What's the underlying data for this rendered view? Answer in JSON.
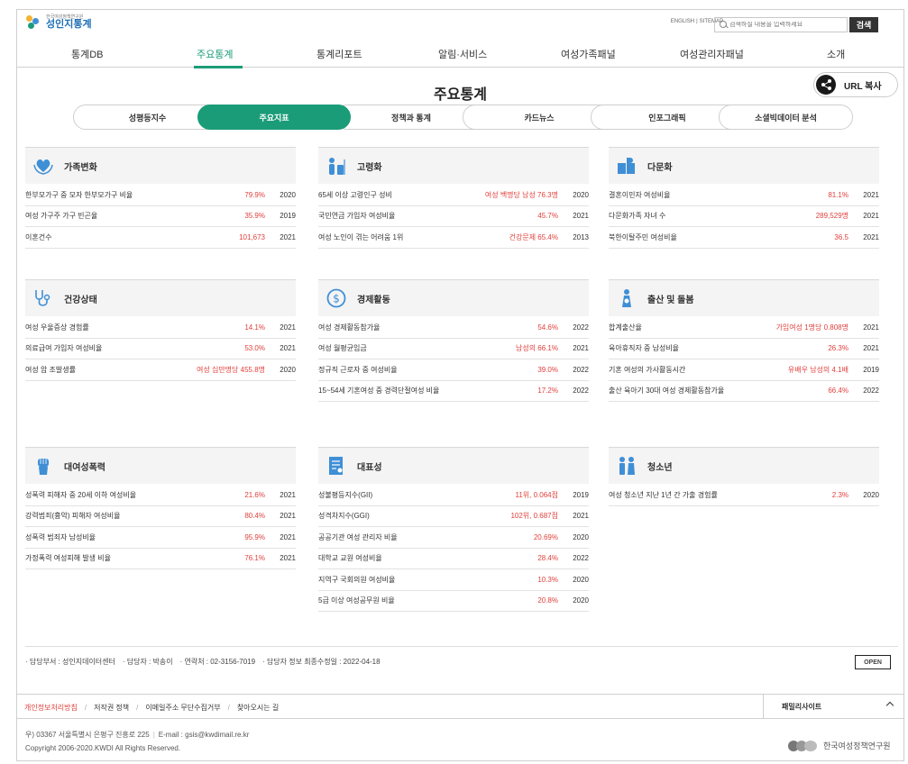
{
  "header": {
    "logo_small": "한국여성정책연구원",
    "logo_main": "성인지통계",
    "util_english": "ENGLISH",
    "util_sitemap": "SITEMAP",
    "search_placeholder": "검색하실 내용을 입력하세요",
    "search_button": "검색"
  },
  "gnb": [
    "통계DB",
    "주요통계",
    "통계리포트",
    "알림·서비스",
    "여성가족패널",
    "여성관리자패널",
    "소개"
  ],
  "gnb_active": "주요통계",
  "page_title": "주요통계",
  "url_copy": "URL 복사",
  "tabs": [
    "성평등지수",
    "주요지표",
    "정책과 통계",
    "카드뉴스",
    "인포그래픽",
    "소셜빅데이터 분석"
  ],
  "tab_active": "주요지표",
  "panels": [
    {
      "icon": "heart-hands-icon",
      "title": "가족변화",
      "rows": [
        {
          "label": "한부모가구 중 모자 한부모가구 비율",
          "value": "79.9%",
          "year": "2020"
        },
        {
          "label": "여성 가구주 가구 빈곤율",
          "value": "35.9%",
          "year": "2019"
        },
        {
          "label": "이혼건수",
          "value": "101,673",
          "year": "2021"
        }
      ]
    },
    {
      "icon": "elderly-icon",
      "title": "고령화",
      "rows": [
        {
          "label": "65세 이상 고령인구 성비",
          "value": "여성 백명당 남성 76.3명",
          "year": "2020"
        },
        {
          "label": "국민연금 가입자 여성비율",
          "value": "45.7%",
          "year": "2021"
        },
        {
          "label": "여성 노인이 겪는 어려움 1위",
          "value": "건강문제 65.4%",
          "year": "2013"
        }
      ]
    },
    {
      "icon": "puzzle-icon",
      "title": "다문화",
      "rows": [
        {
          "label": "결혼이민자 여성비율",
          "value": "81.1%",
          "year": "2021"
        },
        {
          "label": "다문화가족 자녀 수",
          "value": "289,529명",
          "year": "2021"
        },
        {
          "label": "북한이탈주민 여성비율",
          "value": "36.5",
          "year": "2021"
        }
      ]
    },
    {
      "icon": "stethoscope-icon",
      "title": "건강상태",
      "rows": [
        {
          "label": "여성 우울증상 경험률",
          "value": "14.1%",
          "year": "2021"
        },
        {
          "label": "의료급여 가입자 여성비율",
          "value": "53.0%",
          "year": "2021"
        },
        {
          "label": "여성 암 조발생률",
          "value": "여성 십만명당 455.8명",
          "year": "2020"
        }
      ]
    },
    {
      "icon": "coin-icon",
      "title": "경제활동",
      "rows": [
        {
          "label": "여성 경제활동참가율",
          "value": "54.6%",
          "year": "2022"
        },
        {
          "label": "여성 월평균임금",
          "value": "남성의 66.1%",
          "year": "2021"
        },
        {
          "label": "정규직 근로자 중 여성비율",
          "value": "39.0%",
          "year": "2022"
        },
        {
          "label": "15~54세 기혼여성 중 경력단절여성 비율",
          "value": "17.2%",
          "year": "2022"
        }
      ]
    },
    {
      "icon": "mother-child-icon",
      "title": "출산 및 돌봄",
      "rows": [
        {
          "label": "합계출산율",
          "value": "가임여성 1명당 0.808명",
          "year": "2021"
        },
        {
          "label": "육아휴직자 중 남성비율",
          "value": "26.3%",
          "year": "2021"
        },
        {
          "label": "기혼 여성의 가사활동시간",
          "value": "유배우 남성의 4.1배",
          "year": "2019"
        },
        {
          "label": "출산 육아기 30대 여성 경제활동참가율",
          "value": "66.4%",
          "year": "2022"
        }
      ]
    },
    {
      "icon": "raised-fist-icon",
      "title": "대여성폭력",
      "rows": [
        {
          "label": "성폭력 피해자 중 20세 이하 여성비율",
          "value": "21.6%",
          "year": "2021"
        },
        {
          "label": "강력범죄(흉악) 피해자 여성비율",
          "value": "80.4%",
          "year": "2021"
        },
        {
          "label": "성폭력 범죄자 남성비율",
          "value": "95.9%",
          "year": "2021"
        },
        {
          "label": "가정폭력 여성피해 발생 비율",
          "value": "76.1%",
          "year": "2021"
        }
      ]
    },
    {
      "icon": "document-icon",
      "title": "대표성",
      "rows": [
        {
          "label": "성불평등지수(GII)",
          "value": "11위, 0.064점",
          "year": "2019"
        },
        {
          "label": "성격차지수(GGI)",
          "value": "102위, 0.687점",
          "year": "2021"
        },
        {
          "label": "공공기관 여성 관리자 비율",
          "value": "20.69%",
          "year": "2020"
        },
        {
          "label": "대학교 교원 여성비율",
          "value": "28.4%",
          "year": "2022"
        },
        {
          "label": "지역구 국회의원 여성비율",
          "value": "10.3%",
          "year": "2020"
        },
        {
          "label": "5급 이상 여성공무원 비율",
          "value": "20.8%",
          "year": "2020"
        }
      ]
    },
    {
      "icon": "youth-icon",
      "title": "청소년",
      "rows": [
        {
          "label": "여성 청소년 지난 1년 간 가출 경험률",
          "value": "2.3%",
          "year": "2020"
        }
      ]
    }
  ],
  "info": {
    "dept": "· 담당부서 : 성인지데이터센터",
    "person": "· 담당자 : 박송이",
    "contact": "· 연락처 : 02-3156-7019",
    "updated": "· 담당자 정보 최종수정일 : 2022-04-18",
    "open_badge": "OPEN"
  },
  "footer": {
    "links": [
      "개인정보처리방침",
      "저작권 정책",
      "이메일주소 무단수집거부",
      "찾아오시는 길"
    ],
    "family": "패밀리사이트",
    "address": "우) 03367 서울특별시 은평구 진흥로 225",
    "email": "E-mail : gsis@kwdimail.re.kr",
    "copyright": "Copyright 2006-2020.KWDI All Rights Reserved.",
    "org": "한국여성정책연구원"
  },
  "colors": {
    "accent": "#1b9c78",
    "value": "#e0413d",
    "icon": "#3f8fd6"
  }
}
